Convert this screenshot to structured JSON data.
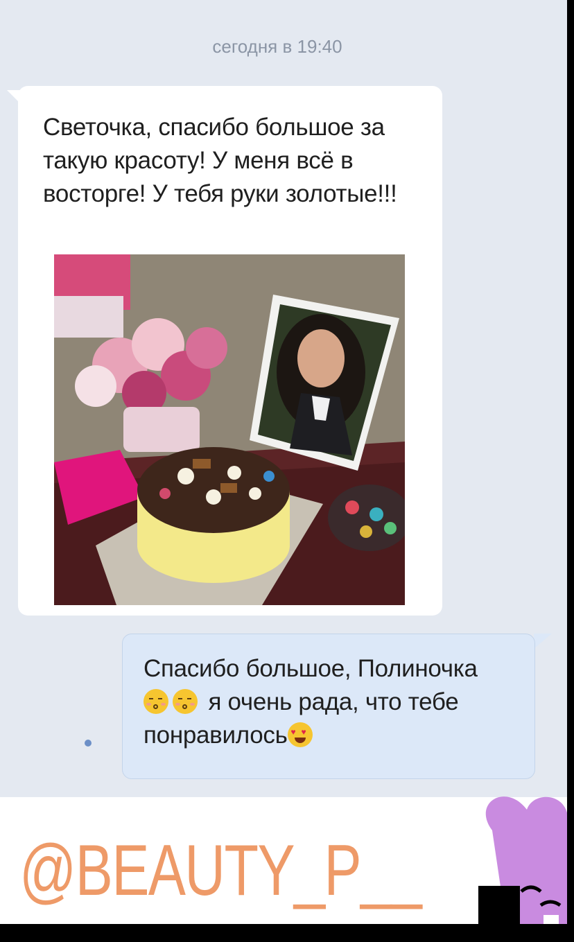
{
  "chat": {
    "date_label": "сегодня в 19:40",
    "incoming": {
      "text": "Светочка, спасибо большое за такую красоту! У меня всё в восторге! У тебя руки золотые!!!"
    },
    "outgoing": {
      "line1": "Спасибо большое, Полиночка",
      "line2": "я очень рада, что тебе",
      "line3": "понравилось",
      "emoji": [
        "kissing-face-emoji",
        "kissing-face-emoji",
        "heart-eyes-emoji"
      ],
      "unread": true
    }
  },
  "overlay": {
    "handle": "@BEAUTY_P__"
  },
  "colors": {
    "background": "#e4e9f1",
    "incoming_bubble": "#ffffff",
    "outgoing_bubble": "#dce8f8",
    "handle": "#ee9a68",
    "sticker": "#c98be0"
  }
}
